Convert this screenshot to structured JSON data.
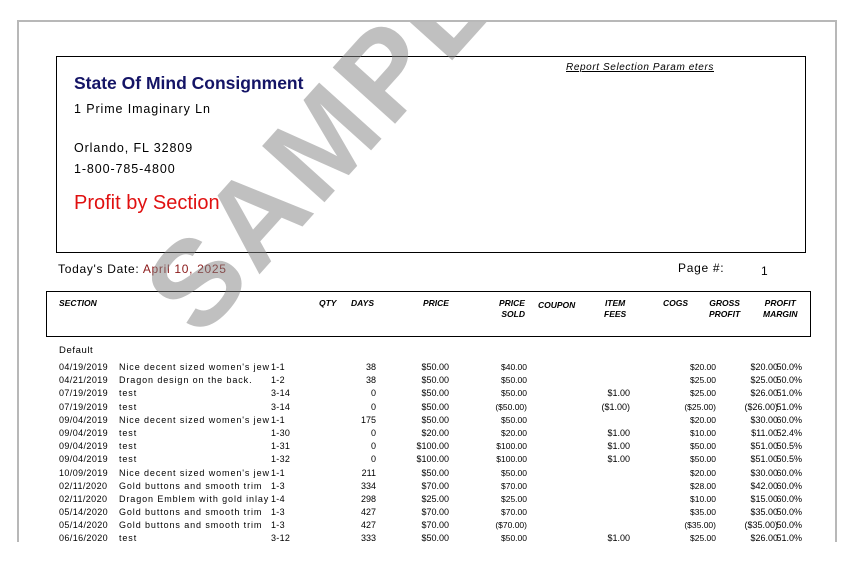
{
  "report": {
    "params_link": "Report Selection Param eters",
    "company": "State Of Mind Consignment",
    "address1": "1 Prime Imaginary Ln",
    "address2": "Orlando, FL 32809",
    "phone": "1-800-785-4800",
    "title": "Profit by Section",
    "today_label": "Today's Date:",
    "today_value": "April 10, 2025",
    "page_label": "Page #:",
    "page_value": "1",
    "watermark": "SAMPLE"
  },
  "columns": {
    "section": "SECTION",
    "qty": "QTY",
    "days": "DAYS",
    "price": "PRICE",
    "price_sold_1": "PRICE",
    "price_sold_2": "SOLD",
    "coupon": "COUPON",
    "item_fees_1": "ITEM",
    "item_fees_2": "FEES",
    "cogs": "COGS",
    "gross_1": "GROSS",
    "gross_2": "PROFIT",
    "margin_1": "PROFIT",
    "margin_2": "MARGIN"
  },
  "group_label": "Default",
  "rows": [
    {
      "date": "04/19/2019",
      "desc": "Nice decent sized women's jewelry",
      "sec": "1-1",
      "days": "38",
      "price": "$50.00",
      "sold": "$40.00",
      "fees": "",
      "cogs": "$20.00",
      "gross": "$20.00",
      "margin": "50.0%"
    },
    {
      "date": "04/21/2019",
      "desc": "Dragon design on the back.",
      "sec": "1-2",
      "days": "38",
      "price": "$50.00",
      "sold": "$50.00",
      "fees": "",
      "cogs": "$25.00",
      "gross": "$25.00",
      "margin": "50.0%"
    },
    {
      "date": "07/19/2019",
      "desc": "test",
      "sec": "3-14",
      "days": "0",
      "price": "$50.00",
      "sold": "$50.00",
      "fees": "$1.00",
      "cogs": "$25.00",
      "gross": "$26.00",
      "margin": "51.0%"
    },
    {
      "date": "07/19/2019",
      "desc": "test",
      "sec": "3-14",
      "days": "0",
      "price": "$50.00",
      "sold": "($50.00)",
      "fees": "($1.00)",
      "cogs": "($25.00)",
      "gross": "($26.00)",
      "margin": "51.0%"
    },
    {
      "date": "09/04/2019",
      "desc": "Nice decent sized women's jewelry",
      "sec": "1-1",
      "days": "175",
      "price": "$50.00",
      "sold": "$50.00",
      "fees": "",
      "cogs": "$20.00",
      "gross": "$30.00",
      "margin": "60.0%"
    },
    {
      "date": "09/04/2019",
      "desc": "test",
      "sec": "1-30",
      "days": "0",
      "price": "$20.00",
      "sold": "$20.00",
      "fees": "$1.00",
      "cogs": "$10.00",
      "gross": "$11.00",
      "margin": "52.4%"
    },
    {
      "date": "09/04/2019",
      "desc": "test",
      "sec": "1-31",
      "days": "0",
      "price": "$100.00",
      "sold": "$100.00",
      "fees": "$1.00",
      "cogs": "$50.00",
      "gross": "$51.00",
      "margin": "50.5%"
    },
    {
      "date": "09/04/2019",
      "desc": "test",
      "sec": "1-32",
      "days": "0",
      "price": "$100.00",
      "sold": "$100.00",
      "fees": "$1.00",
      "cogs": "$50.00",
      "gross": "$51.00",
      "margin": "50.5%"
    },
    {
      "date": "10/09/2019",
      "desc": "Nice decent sized women's jewelry",
      "sec": "1-1",
      "days": "211",
      "price": "$50.00",
      "sold": "$50.00",
      "fees": "",
      "cogs": "$20.00",
      "gross": "$30.00",
      "margin": "60.0%"
    },
    {
      "date": "02/11/2020",
      "desc": "Gold buttons and smooth trim",
      "sec": "1-3",
      "days": "334",
      "price": "$70.00",
      "sold": "$70.00",
      "fees": "",
      "cogs": "$28.00",
      "gross": "$42.00",
      "margin": "60.0%"
    },
    {
      "date": "02/11/2020",
      "desc": "Dragon Emblem with gold inlay",
      "sec": "1-4",
      "days": "298",
      "price": "$25.00",
      "sold": "$25.00",
      "fees": "",
      "cogs": "$10.00",
      "gross": "$15.00",
      "margin": "60.0%"
    },
    {
      "date": "05/14/2020",
      "desc": "Gold buttons and smooth trim",
      "sec": "1-3",
      "days": "427",
      "price": "$70.00",
      "sold": "$70.00",
      "fees": "",
      "cogs": "$35.00",
      "gross": "$35.00",
      "margin": "50.0%"
    },
    {
      "date": "05/14/2020",
      "desc": "Gold buttons and smooth trim",
      "sec": "1-3",
      "days": "427",
      "price": "$70.00",
      "sold": "($70.00)",
      "fees": "",
      "cogs": "($35.00)",
      "gross": "($35.00)",
      "margin": "50.0%"
    },
    {
      "date": "06/16/2020",
      "desc": "test",
      "sec": "3-12",
      "days": "333",
      "price": "$50.00",
      "sold": "$50.00",
      "fees": "$1.00",
      "cogs": "$25.00",
      "gross": "$26.00",
      "margin": "51.0%"
    }
  ]
}
